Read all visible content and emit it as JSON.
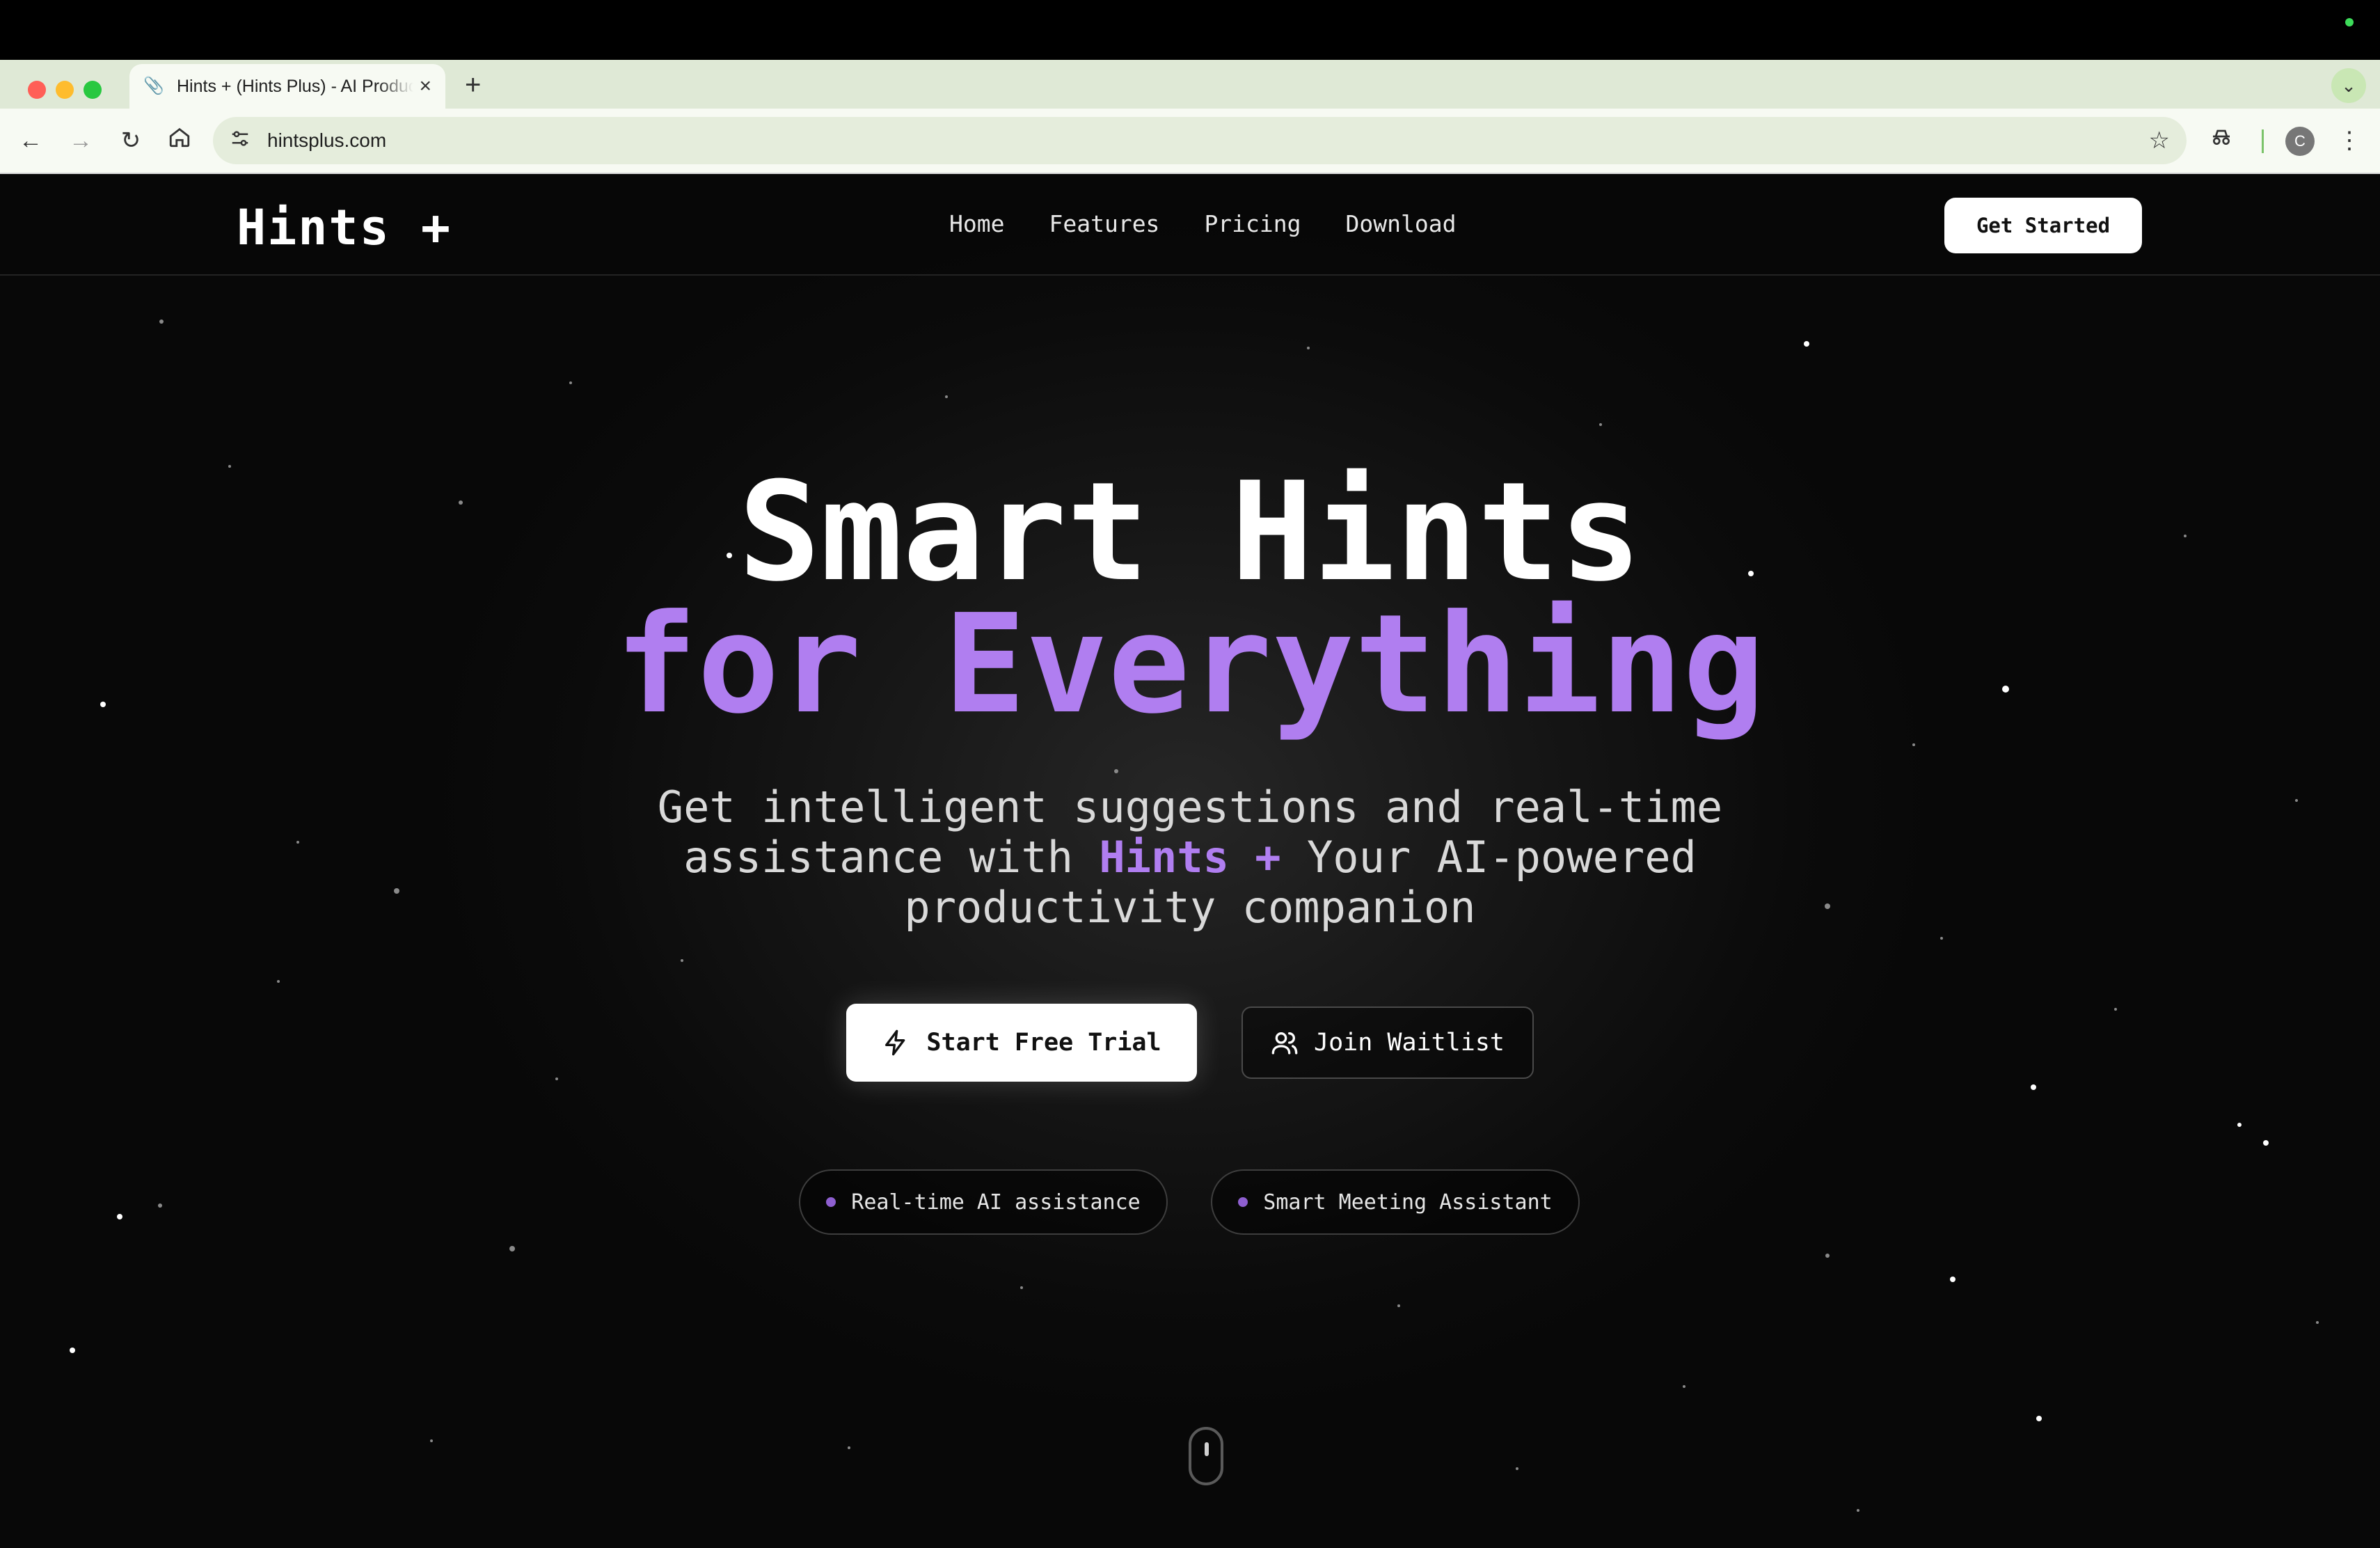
{
  "browser": {
    "tab_title": "Hints + (Hints Plus) - AI Productivity",
    "new_tab_icon": "plus-icon",
    "url": "hintsplus.com",
    "profile_initial": "C"
  },
  "site": {
    "logo": "Hints +",
    "nav": [
      "Home",
      "Features",
      "Pricing",
      "Download"
    ],
    "get_started": "Get Started"
  },
  "hero": {
    "title_line1": "Smart Hints",
    "title_line2": "for Everything",
    "subtitle_part1": "Get intelligent suggestions and real-time",
    "subtitle_part2a": "assistance with ",
    "subtitle_brand": "Hints +",
    "subtitle_part2b": " Your AI-powered",
    "subtitle_part3": "productivity companion",
    "primary_cta": "Start Free Trial",
    "secondary_cta": "Join Waitlist",
    "pills": [
      "Real-time AI assistance",
      "Smart Meeting Assistant"
    ]
  },
  "colors": {
    "accent": "#b07ef0",
    "background": "#0b0b0b",
    "pill_dot": "#8e5fd0"
  }
}
